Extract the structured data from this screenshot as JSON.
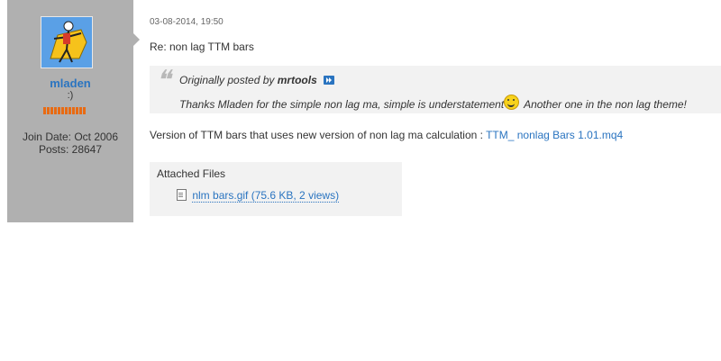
{
  "user": {
    "username": "mladen",
    "title": ":)",
    "join_date": "Join Date: Oct 2006",
    "posts": "Posts: 28647",
    "reputation_bars": 12
  },
  "post": {
    "date": "03-08-2014, 19:50",
    "title": "Re: non lag TTM bars",
    "quote": {
      "prefix": "Originally posted by",
      "author": "mrtools",
      "text_before_smiley": "Thanks Mladen for the simple non lag ma, simple is understatement",
      "text_after_smiley": "Another one in the non lag theme!"
    },
    "body_text": "Version of TTM bars that uses new version of non lag ma calculation :",
    "body_link": "TTM_ nonlag Bars 1.01.mq4"
  },
  "attachments": {
    "heading": "Attached Files",
    "files": [
      {
        "label": "nlm bars.gif (75.6 KB, 2 views)"
      }
    ]
  },
  "colors": {
    "sidebar": "#b0b0b0",
    "link": "#2a74c0",
    "reputation": "#e86b13",
    "quote_bg": "#f2f2f2"
  }
}
